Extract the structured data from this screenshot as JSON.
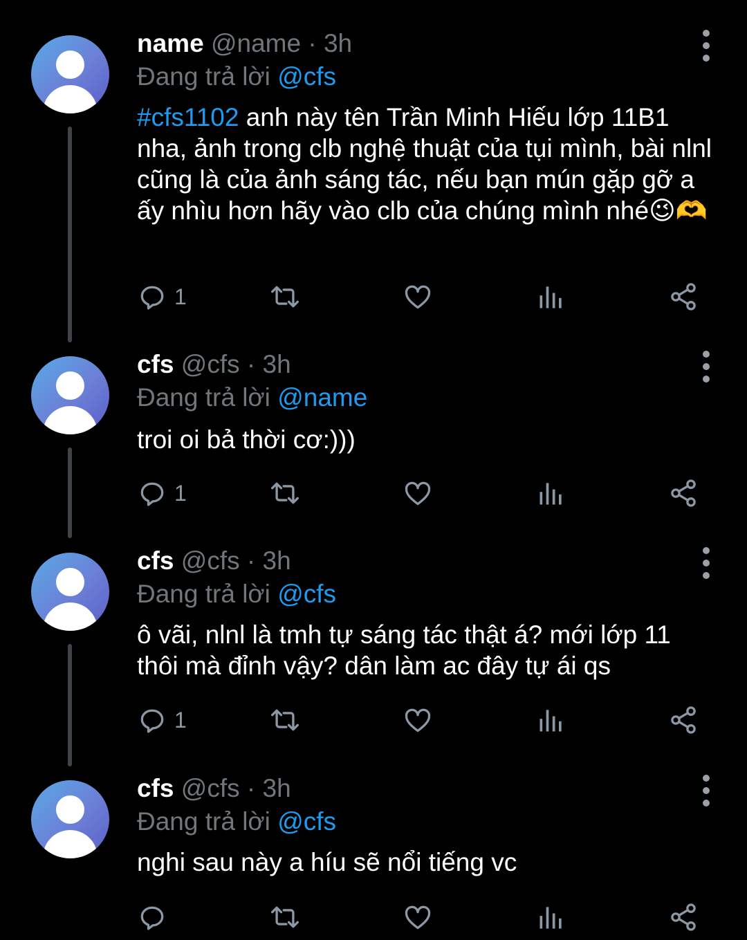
{
  "tweets": [
    {
      "name": "name",
      "handle": "@name",
      "time": "· 3h",
      "reply_prefix": "Đang trả lời",
      "reply_to": "@cfs",
      "hashtag": "#cfs1102",
      "text": " anh này tên Trần Minh Hiếu lớp 11B1 nha, ảnh trong clb nghệ thuật của tụi mình, bài nlnl cũng là của ảnh sáng tác, nếu bạn mún gặp gỡ a ấy nhìu hơn hãy vào clb của chúng mình nhé😉🫶",
      "reply_count": "1"
    },
    {
      "name": "cfs",
      "handle": "@cfs",
      "time": "· 3h",
      "reply_prefix": "Đang trả lời",
      "reply_to": "@name",
      "text": "troi oi bả thời cơ:)))",
      "reply_count": "1"
    },
    {
      "name": "cfs",
      "handle": "@cfs",
      "time": "· 3h",
      "reply_prefix": "Đang trả lời",
      "reply_to": "@cfs",
      "text": "ô vãi, nlnl là tmh tự sáng tác thật á? mới lớp 11 thôi mà đỉnh vậy? dân làm ac đây tự ái qs",
      "reply_count": "1"
    },
    {
      "name": "cfs",
      "handle": "@cfs",
      "time": "· 3h",
      "reply_prefix": "Đang trả lời",
      "reply_to": "@cfs",
      "text": "nghi sau này a híu sẽ nổi tiếng vc",
      "reply_count": ""
    }
  ],
  "icons": {
    "reply": "reply-bubble-icon",
    "retweet": "retweet-icon",
    "like": "heart-icon",
    "views": "analytics-icon",
    "share": "share-icon",
    "more": "more-vertical-icon"
  },
  "colors": {
    "background": "#000000",
    "link": "#1d9bf0",
    "muted": "#71767b",
    "icon": "#8b98a5"
  }
}
